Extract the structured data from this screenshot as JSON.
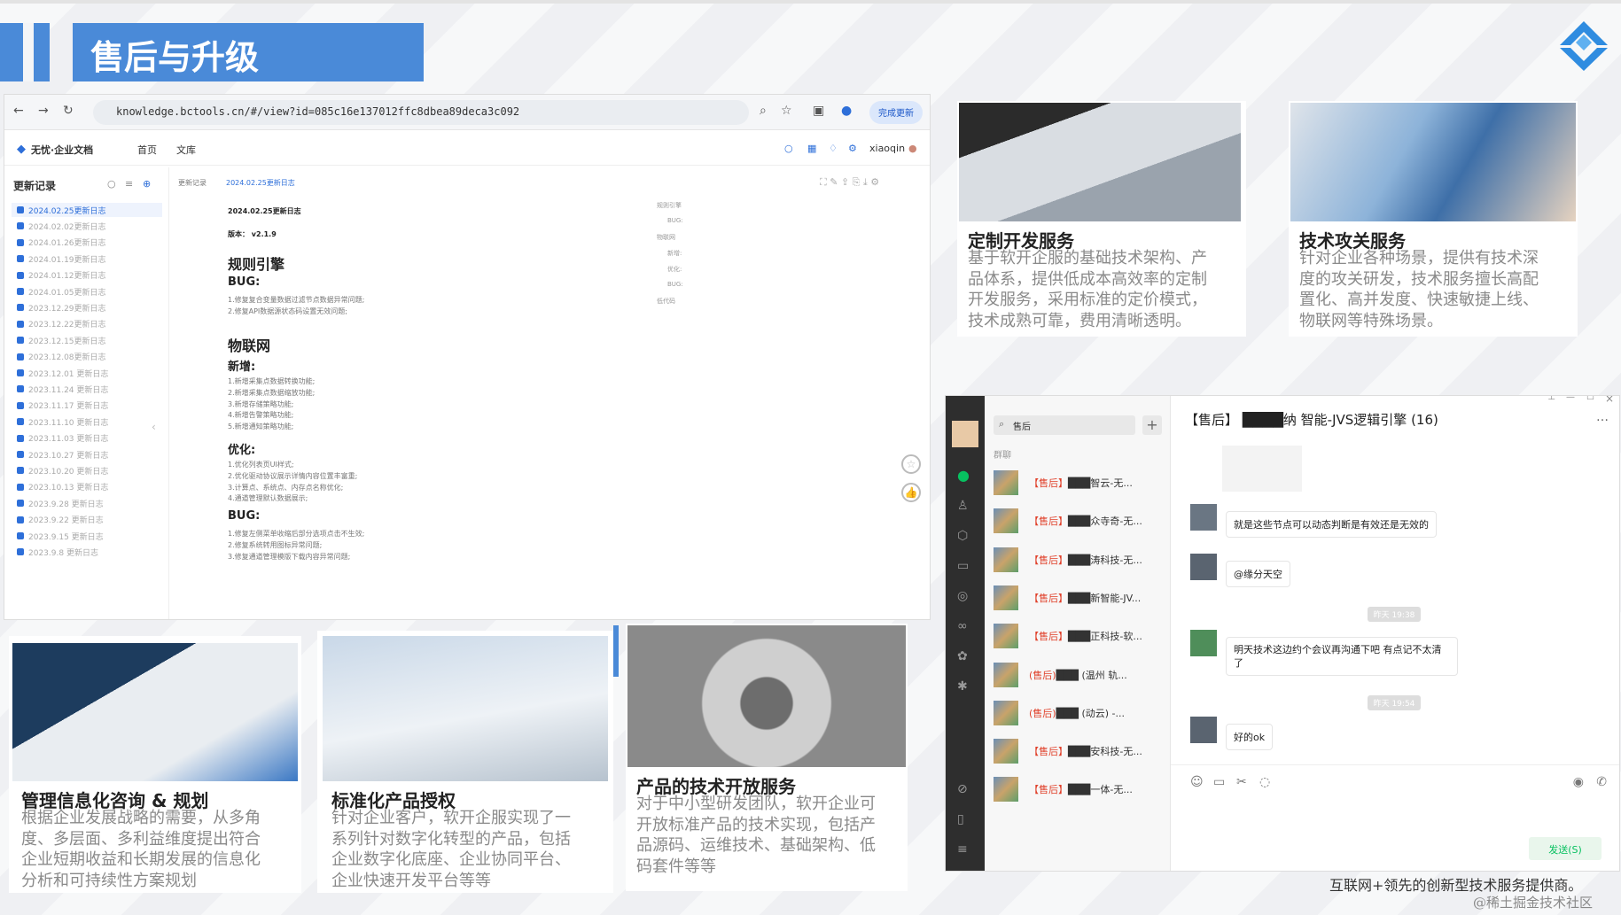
{
  "slide": {
    "title": "售后与升级",
    "footer": "互联网+领先的创新型技术服务提供商。",
    "watermark": "@稀土掘金技术社区"
  },
  "browser": {
    "url": "knowledge.bctools.cn/#/view?id=085c16e137012ffc8dbea89deca3c092",
    "update_label": "完成更新",
    "app_name": "无忧·企业文档",
    "nav": [
      "首页",
      "文库"
    ],
    "user": "xiaoqin",
    "sidebar_title": "更新记录",
    "sidebar_items": [
      "2024.02.25更新日志",
      "2024.02.02更新日志",
      "2024.01.26更新日志",
      "2024.01.19更新日志",
      "2024.01.12更新日志",
      "2024.01.05更新日志",
      "2023.12.29更新日志",
      "2023.12.22更新日志",
      "2023.12.15更新日志",
      "2023.12.08更新日志",
      "2023.12.01 更新日志",
      "2023.11.24 更新日志",
      "2023.11.17 更新日志",
      "2023.11.10 更新日志",
      "2023.11.03 更新日志",
      "2023.10.27 更新日志",
      "2023.10.20 更新日志",
      "2023.10.13 更新日志",
      "2023.9.28 更新日志",
      "2023.9.22 更新日志",
      "2023.9.15 更新日志",
      "2023.9.8 更新日志"
    ],
    "breadcrumb": [
      "更新记录",
      "2024.02.25更新日志"
    ],
    "doc_title": "2024.02.25更新日志",
    "version": "版本： v2.1.9",
    "sec1": "规则引擎",
    "sec1_bug": "BUG:",
    "sec1_lines": [
      "1.修复复合变量数据过滤节点数据异常问题;",
      "2.修复API数据源状态码设置无效问题;"
    ],
    "sec2": "物联网",
    "sec2_new": "新增:",
    "sec2_new_lines": [
      "1.新增采集点数据转换功能;",
      "2.新增采集点数据缩放功能;",
      "3.新增存储策略功能;",
      "4.新增告警策略功能;",
      "5.新增通知策略功能;"
    ],
    "sec2_opt": "优化:",
    "sec2_opt_lines": [
      "1.优化列表页UI样式;",
      "2.优化驱动协议展示详情内容位置丰富重;",
      "3.计算点、系统点、内存点名称优化;",
      "4.通道管理默认数据展示;"
    ],
    "sec2_bug": "BUG:",
    "sec2_bug_lines": [
      "1.修复左侧菜单收缩后部分选项点击不生效;",
      "2.修复系统转用图标异常问题;",
      "3.修复通道管理模版下载内容异常问题;"
    ],
    "toc": [
      "规则引擎",
      "BUG:",
      "物联网",
      "新增:",
      "优化:",
      "BUG:",
      "低代码"
    ]
  },
  "cards": [
    {
      "title": "定制开发服务",
      "desc": [
        "基于软开企服的基础技术架构、产",
        "品体系，提供低成本高效率的定制",
        "开发服务，采用标准的定价模式，",
        "技术成熟可靠，费用清晰透明。"
      ]
    },
    {
      "title": "技术攻关服务",
      "desc": [
        "针对企业各种场景，提供有技术深",
        "度的攻关研发，技术服务擅长高配",
        "置化、高并发度、快速敏捷上线、",
        "物联网等特殊场景。"
      ]
    },
    {
      "title": "管理信息化咨询 & 规划",
      "desc": [
        "根据企业发展战略的需要，从多角",
        "度、多层面、多利益维度提出符合",
        "企业短期收益和长期发展的信息化",
        "分析和可持续性方案规划"
      ]
    },
    {
      "title": "标准化产品授权",
      "desc": [
        "针对企业客户，软开企服实现了一",
        "系列针对数字化转型的产品，包括",
        "企业数字化底座、企业协同平台、",
        "企业快速开发平台等等"
      ]
    },
    {
      "title": "产品的技术开放服务",
      "desc": [
        "对于中小型研发团队，软开企业可",
        "开放标准产品的技术实现，包括产",
        "品源码、运维技术、基础架构、低",
        "码套件等等"
      ]
    }
  ],
  "chat": {
    "search": "售后",
    "group_label": "群聊",
    "header": "【售后】 ████纳 智能-JVS逻辑引擎 (16)",
    "list": [
      {
        "tag": "【售后】",
        "name": "███智云-无..."
      },
      {
        "tag": "【售后】",
        "name": "███众寺奇-无..."
      },
      {
        "tag": "【售后】",
        "name": "███涛科技-无..."
      },
      {
        "tag": "【售后】",
        "name": "███新智能-JV..."
      },
      {
        "tag": "【售后】",
        "name": "███正科技-软..."
      },
      {
        "tag": "(售后)",
        "name": "███ (温州 轨..."
      },
      {
        "tag": "(售后)",
        "name": "███ (动云) -..."
      },
      {
        "tag": "【售后】",
        "name": "███安科技-无..."
      },
      {
        "tag": "【售后】",
        "name": "███一体-无..."
      }
    ],
    "messages": [
      "就是这些节点可以动态判断是有效还是无效的",
      "@缘分天空",
      "明天技术这边约个会议再沟通下吧 有点记不太清",
      "了",
      "好的ok"
    ],
    "times": [
      "昨天 19:38",
      "昨天 19:54"
    ],
    "send": "发送(S)"
  }
}
